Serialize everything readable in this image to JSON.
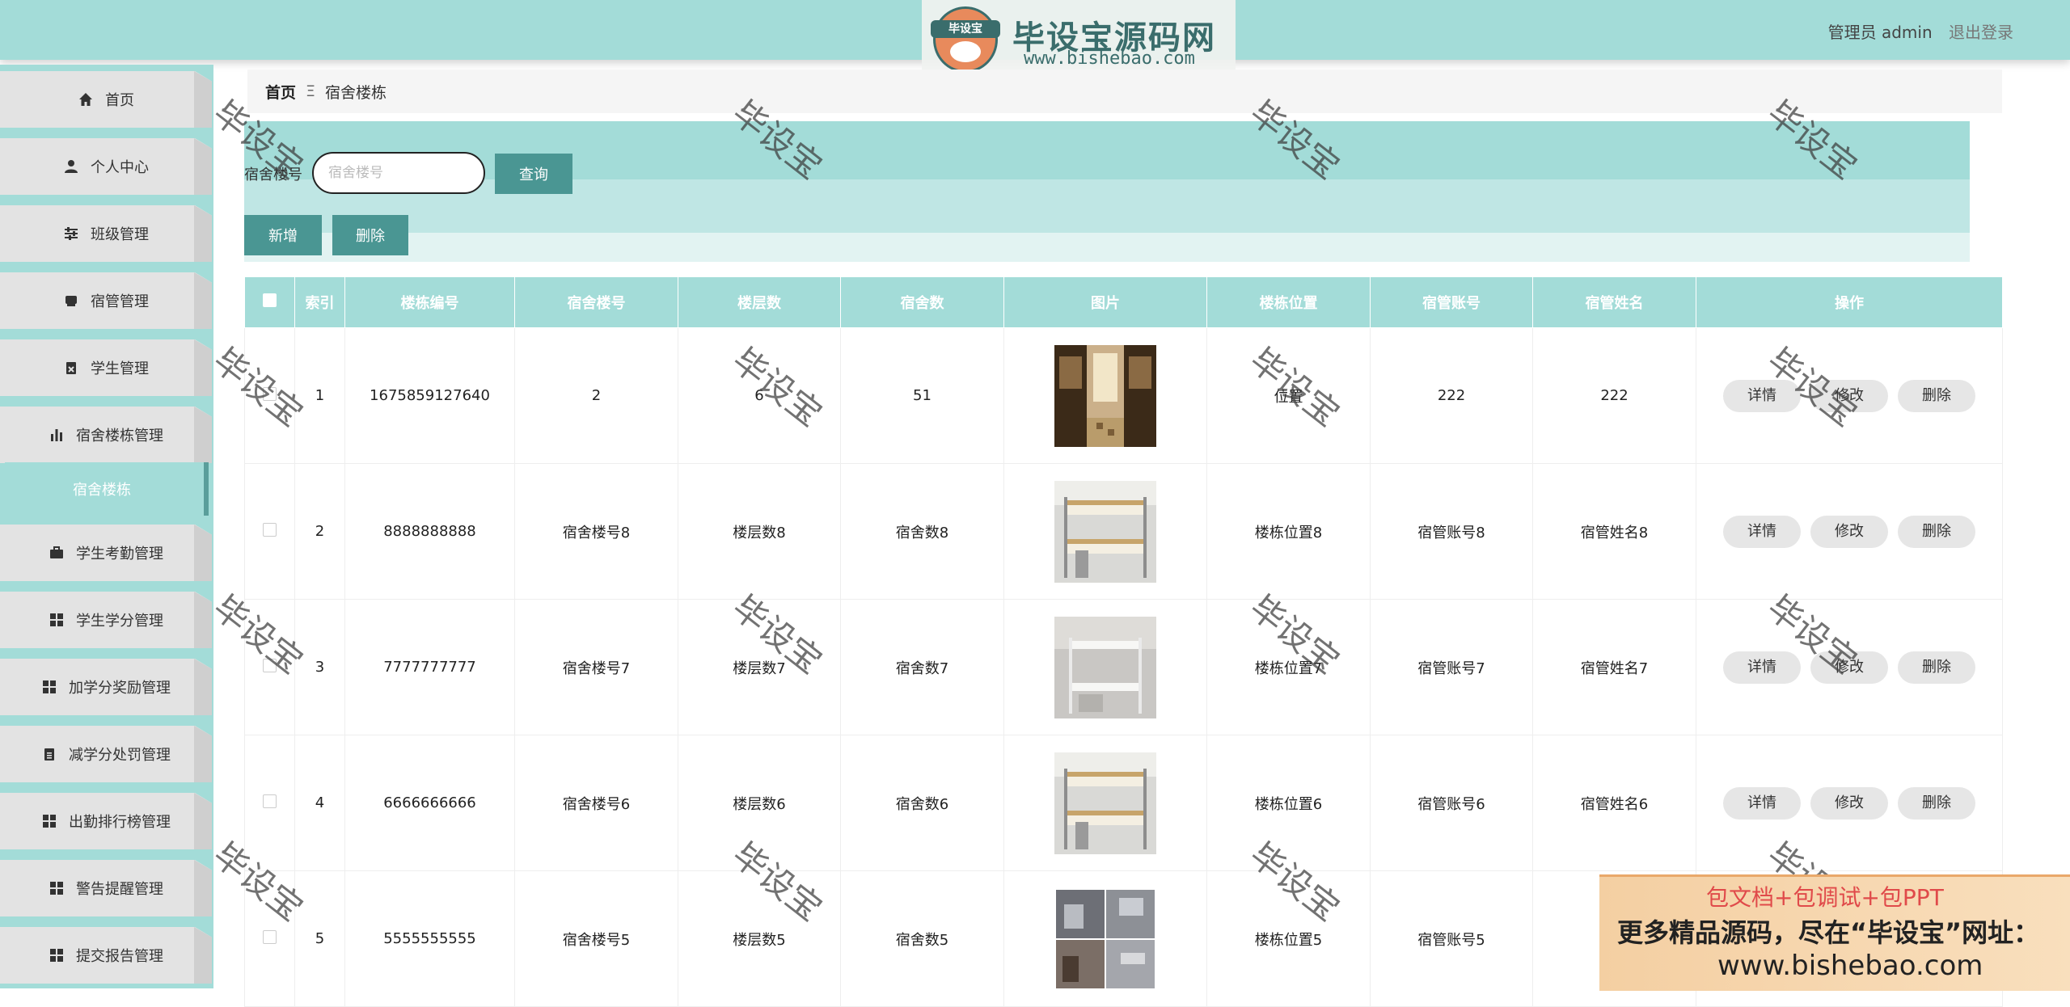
{
  "header": {
    "user_label": "管理员 admin",
    "logout": "退出登录"
  },
  "logo": {
    "badge": "毕设宝",
    "title": "毕设宝源码网",
    "url": "www.bishebao.com"
  },
  "sidebar": {
    "items": [
      {
        "label": "首页",
        "icon": "home-icon"
      },
      {
        "label": "个人中心",
        "icon": "user-icon"
      },
      {
        "label": "班级管理",
        "icon": "sliders-icon"
      },
      {
        "label": "宿管管理",
        "icon": "inbox-icon"
      },
      {
        "label": "学生管理",
        "icon": "clipboard-icon"
      },
      {
        "label": "宿舍楼栋管理",
        "icon": "bar-chart-icon"
      },
      {
        "label": "学生考勤管理",
        "icon": "briefcase-icon"
      },
      {
        "label": "学生学分管理",
        "icon": "grid-icon"
      },
      {
        "label": "加学分奖励管理",
        "icon": "grid-icon"
      },
      {
        "label": "减学分处罚管理",
        "icon": "clipboard-list-icon"
      },
      {
        "label": "出勤排行榜管理",
        "icon": "grid-icon"
      },
      {
        "label": "警告提醒管理",
        "icon": "grid-icon"
      },
      {
        "label": "提交报告管理",
        "icon": "grid-icon"
      }
    ],
    "active_sub": "宿舍楼栋"
  },
  "breadcrumb": {
    "home": "首页",
    "separator": "Ξ",
    "current": "宿舍楼栋"
  },
  "search": {
    "label": "宿舍楼号",
    "placeholder": "宿舍楼号",
    "query_button": "查询"
  },
  "actions": {
    "add": "新增",
    "delete": "删除"
  },
  "table": {
    "columns": [
      "索引",
      "楼栋编号",
      "宿舍楼号",
      "楼层数",
      "宿舍数",
      "图片",
      "楼栋位置",
      "宿管账号",
      "宿管姓名",
      "操作"
    ],
    "rows": [
      {
        "index": "1",
        "code": "1675859127640",
        "building": "2",
        "floors": "6",
        "rooms": "51",
        "image": "dorm-corridor",
        "location": "位置",
        "account": "222",
        "manager": "222"
      },
      {
        "index": "2",
        "code": "8888888888",
        "building": "宿舍楼号8",
        "floors": "楼层数8",
        "rooms": "宿舍数8",
        "image": "bunk-bed",
        "location": "楼栋位置8",
        "account": "宿管账号8",
        "manager": "宿管姓名8"
      },
      {
        "index": "3",
        "code": "7777777777",
        "building": "宿舍楼号7",
        "floors": "楼层数7",
        "rooms": "宿舍数7",
        "image": "white-bunk",
        "location": "楼栋位置7",
        "account": "宿管账号7",
        "manager": "宿管姓名7"
      },
      {
        "index": "4",
        "code": "6666666666",
        "building": "宿舍楼号6",
        "floors": "楼层数6",
        "rooms": "宿舍数6",
        "image": "bunk-bed",
        "location": "楼栋位置6",
        "account": "宿管账号6",
        "manager": "宿管姓名6"
      },
      {
        "index": "5",
        "code": "5555555555",
        "building": "宿舍楼号5",
        "floors": "楼层数5",
        "rooms": "宿舍数5",
        "image": "room-collage",
        "location": "楼栋位置5",
        "account": "宿管账号5",
        "manager": "宿"
      }
    ],
    "row_buttons": {
      "detail": "详情",
      "edit": "修改",
      "delete": "删除"
    }
  },
  "watermark": "毕设宝",
  "ad": {
    "line1": "包文档+包调试+包PPT",
    "line2": "更多精品源码，尽在“毕设宝”网址：",
    "line3": "www.bishebao.com"
  },
  "colors": {
    "accent": "#a3dcd8",
    "button": "#4a9693",
    "sidebar_item": "#e3e3e3"
  }
}
